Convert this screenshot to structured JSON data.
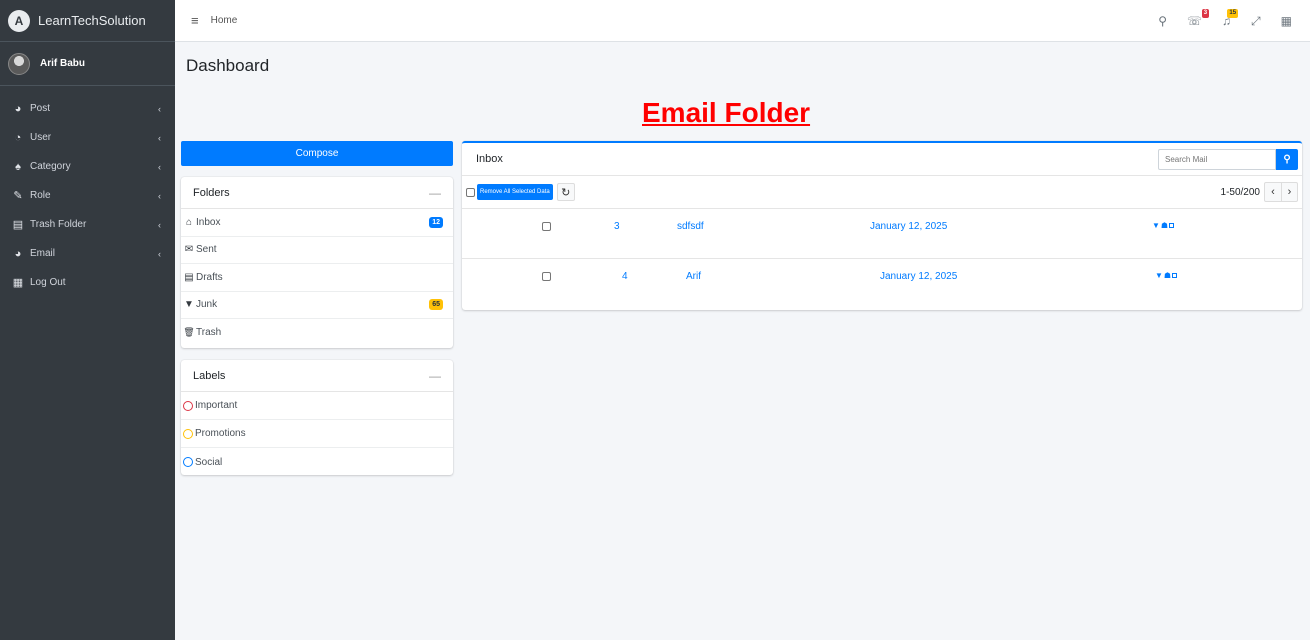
{
  "brand": {
    "name": "LearnTechSolution",
    "logo_letter": "A"
  },
  "user": {
    "name": "Arif Babu"
  },
  "sidebar": {
    "items": [
      {
        "label": "Post",
        "icon": "tachometer-icon",
        "glyph": "◕",
        "chevron": "‹"
      },
      {
        "label": "User",
        "icon": "pie-chart-icon",
        "glyph": "◔",
        "chevron": "‹"
      },
      {
        "label": "Category",
        "icon": "tree-icon",
        "glyph": "♠",
        "chevron": "‹"
      },
      {
        "label": "Role",
        "icon": "edit-icon",
        "glyph": "✎",
        "chevron": "‹"
      },
      {
        "label": "Trash Folder",
        "icon": "archive-icon",
        "glyph": "▤",
        "chevron": "‹"
      },
      {
        "label": "Email",
        "icon": "tachometer-icon",
        "glyph": "◕",
        "chevron": "‹"
      },
      {
        "label": "Log Out",
        "icon": "grid-icon",
        "glyph": "▦",
        "chevron": ""
      }
    ]
  },
  "topbar": {
    "menu_glyph": "≡",
    "home_label": "Home",
    "icons": [
      {
        "name": "search-icon",
        "glyph": "⚲",
        "badge": ""
      },
      {
        "name": "messages-icon",
        "glyph": "☏",
        "badge": "3"
      },
      {
        "name": "notifications-icon",
        "glyph": "♫",
        "badge": "15"
      },
      {
        "name": "fullscreen-icon",
        "glyph": "⤢",
        "badge": ""
      },
      {
        "name": "apps-icon",
        "glyph": "▦",
        "badge": ""
      }
    ]
  },
  "page": {
    "title": "Dashboard",
    "heading": "Email Folder"
  },
  "compose": {
    "label": "Compose"
  },
  "folders": {
    "title": "Folders",
    "collapse": "—",
    "items": [
      {
        "label": "Inbox",
        "glyph": "⌂",
        "badge": "12",
        "badge_color": "#007bff"
      },
      {
        "label": "Sent",
        "glyph": "✉",
        "badge": "",
        "badge_color": ""
      },
      {
        "label": "Drafts",
        "glyph": "▤",
        "badge": "",
        "badge_color": ""
      },
      {
        "label": "Junk",
        "glyph": "▼",
        "badge": "65",
        "badge_color": "#ffc107"
      },
      {
        "label": "Trash",
        "glyph": "🗑",
        "badge": "",
        "badge_color": ""
      }
    ]
  },
  "labels": {
    "title": "Labels",
    "collapse": "—",
    "items": [
      {
        "label": "Important",
        "color": "#dc3545"
      },
      {
        "label": "Promotions",
        "color": "#ffc107"
      },
      {
        "label": "Social",
        "color": "#007bff"
      }
    ]
  },
  "inbox": {
    "title": "Inbox",
    "search_placeholder": "Search Mail",
    "remove_label": "Remove All Selected Data",
    "refresh_glyph": "↻",
    "pager_text": "1-50/200",
    "prev_glyph": "‹",
    "next_glyph": "›",
    "rows": [
      {
        "id": "3",
        "subject": "sdfsdf",
        "date": "January 12, 2025"
      },
      {
        "id": "4",
        "subject": "Arif",
        "date": "January 12, 2025"
      }
    ]
  },
  "colors": {
    "accent": "#007bff",
    "sidebar": "#343a40",
    "heading": "#ff0000"
  }
}
